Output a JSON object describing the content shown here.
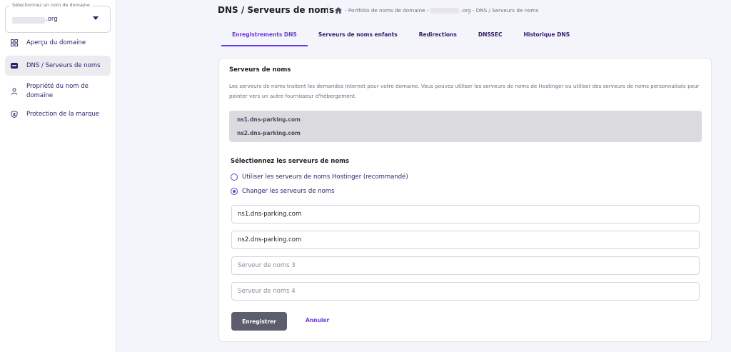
{
  "sidebar": {
    "domain_select": {
      "legend": "Sélectionnez un nom de domaine",
      "tld": ".org"
    },
    "items": [
      {
        "label": "Aperçu du domaine",
        "icon": "grid-icon"
      },
      {
        "label": "DNS / Serveurs de noms",
        "icon": "dns-icon"
      },
      {
        "label": "Propriété du nom de domaine",
        "icon": "person-icon"
      },
      {
        "label": "Protection de la marque",
        "icon": "shield-icon"
      }
    ]
  },
  "header": {
    "title": "DNS / Serveurs de noms",
    "breadcrumb_prefix": "- Portfolio de noms de domaine -",
    "breadcrumb_suffix": ".org - DNS / Serveurs de noms"
  },
  "tabs": [
    {
      "label": "Enregistrements DNS"
    },
    {
      "label": "Serveurs de noms enfants"
    },
    {
      "label": "Redirections"
    },
    {
      "label": "DNSSEC"
    },
    {
      "label": "Historique DNS"
    }
  ],
  "card": {
    "title": "Serveurs de noms",
    "description": "Les serveurs de noms traitent les demandes Internet pour votre domaine. Vous pouvez utiliser les serveurs de noms de Hostinger ou utiliser des serveurs de noms personnalisés pour pointer vers un autre fournisseur d'hébergement.",
    "current_ns": [
      "ns1.dns-parking.com",
      "ns2.dns-parking.com"
    ],
    "select_title": "Sélectionnez les serveurs de noms",
    "options": [
      {
        "label": "Utiliser les serveurs de noms Hostinger (recommandé)",
        "checked": false
      },
      {
        "label": "Changer les serveurs de noms",
        "checked": true
      }
    ],
    "fields": [
      {
        "value": "ns1.dns-parking.com",
        "placeholder": ""
      },
      {
        "value": "ns2.dns-parking.com",
        "placeholder": ""
      },
      {
        "value": "",
        "placeholder": "Serveur de noms 3"
      },
      {
        "value": "",
        "placeholder": "Serveur de noms 4"
      }
    ],
    "save_label": "Enregistrer",
    "cancel_label": "Annuler"
  },
  "colors": {
    "accent": "#673de6",
    "text": "#2f1c6a",
    "save_button": "#5c5e70"
  }
}
